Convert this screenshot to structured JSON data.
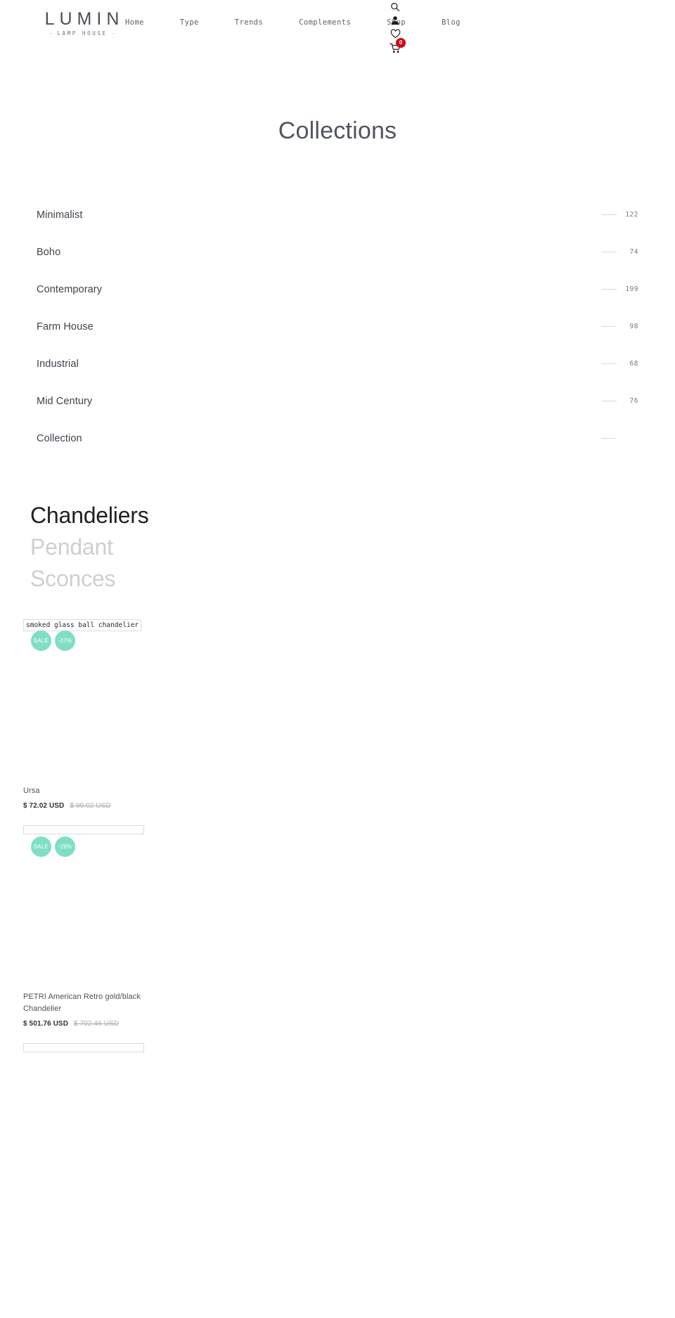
{
  "header": {
    "logo": {
      "mark": "LUMIN",
      "sub": "LAMP HOUSE",
      "rule_left": "—",
      "rule_right": "—"
    },
    "nav": [
      {
        "label": "Home"
      },
      {
        "label": "Type"
      },
      {
        "label": "Trends"
      },
      {
        "label": "Complements"
      },
      {
        "label": "Shop"
      },
      {
        "label": "Blog"
      }
    ],
    "icons": {
      "search": "search-icon",
      "account": "user-icon",
      "wishlist": "heart-icon",
      "cart": "cart-icon"
    },
    "cart_count": "0",
    "cart_badge_color": "#d40511"
  },
  "page": {
    "title": "Collections"
  },
  "collections": [
    {
      "name": "Minimalist",
      "count": "122"
    },
    {
      "name": "Boho",
      "count": "74"
    },
    {
      "name": "Contemporary",
      "count": "199"
    },
    {
      "name": "Farm House",
      "count": "98"
    },
    {
      "name": "Industrial",
      "count": "68"
    },
    {
      "name": "Mid Century",
      "count": "76"
    },
    {
      "name": "Collection",
      "count": ""
    }
  ],
  "categories": [
    {
      "label": "Chandeliers",
      "active": true
    },
    {
      "label": "Pendant",
      "active": false
    },
    {
      "label": "Sconces",
      "active": false
    }
  ],
  "products": [
    {
      "alt_text": "smoked glass ball chandelier",
      "badges": [
        {
          "label": "SALE"
        },
        {
          "label": "-27%"
        }
      ],
      "title": "Ursa",
      "price_sale": "$ 72.02 USD",
      "price_compare": "$ 99.02 USD"
    },
    {
      "alt_text": "",
      "badges": [
        {
          "label": "SALE"
        },
        {
          "label": "-29%"
        }
      ],
      "title": "PETRI American Retro gold/black Chandelier",
      "price_sale": "$ 501.76 USD",
      "price_compare": "$ 702.46 USD"
    },
    {
      "alt_text": "",
      "badges": [],
      "title": "",
      "price_sale": "",
      "price_compare": ""
    }
  ],
  "theme": {
    "badge_color": "#7fdfc4",
    "text_color": "#3d3d47",
    "muted_color": "#cfcfd2"
  }
}
